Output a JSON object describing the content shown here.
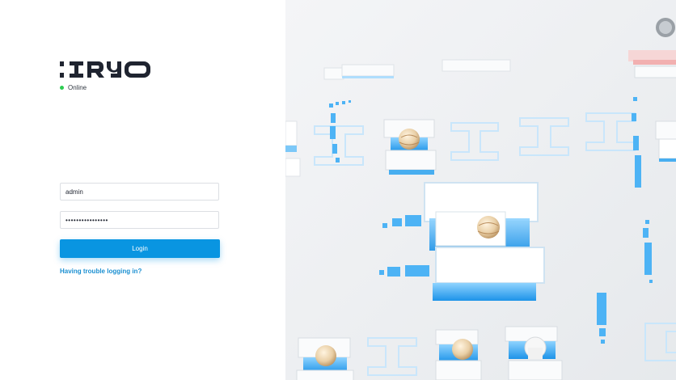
{
  "brand": {
    "logo_text": ":IRYO",
    "logo_color": "#1f2430"
  },
  "status": {
    "text": "Online",
    "dot_color": "#2ecc52"
  },
  "form": {
    "username_value": "admin",
    "password_value": "••••••••••••••••",
    "login_label": "Login",
    "login_color": "#0995e1",
    "trouble_link": "Having trouble logging in?",
    "link_color": "#1a8fd1"
  },
  "illustration": {
    "subject": "isometric blocks with characters",
    "accent_color": "#3aa9f2"
  }
}
